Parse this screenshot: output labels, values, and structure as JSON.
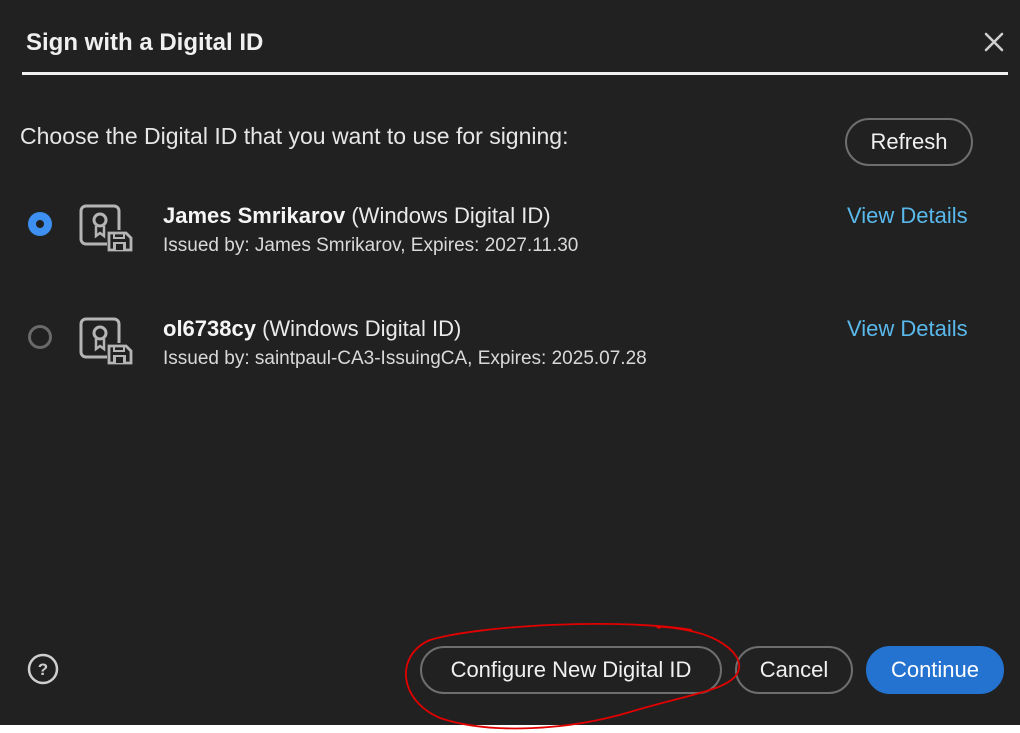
{
  "dialog": {
    "title": "Sign with a Digital ID",
    "prompt": "Choose the Digital ID that you want to use for signing:",
    "refresh_label": "Refresh"
  },
  "ids": [
    {
      "name": "James Smrikarov",
      "type": " (Windows Digital ID)",
      "issued": "Issued by: James Smrikarov, Expires: 2027.11.30",
      "details_label": "View Details",
      "selected": true
    },
    {
      "name": "ol6738cy",
      "type": " (Windows Digital ID)",
      "issued": "Issued by: saintpaul-CA3-IssuingCA, Expires: 2025.07.28",
      "details_label": "View Details",
      "selected": false
    }
  ],
  "footer": {
    "configure_label": "Configure New Digital ID",
    "cancel_label": "Cancel",
    "continue_label": "Continue"
  },
  "colors": {
    "accent": "#2573d0",
    "link": "#5ab9ec",
    "radio_selected": "#3d8ff0",
    "annotation": "#e00000"
  }
}
